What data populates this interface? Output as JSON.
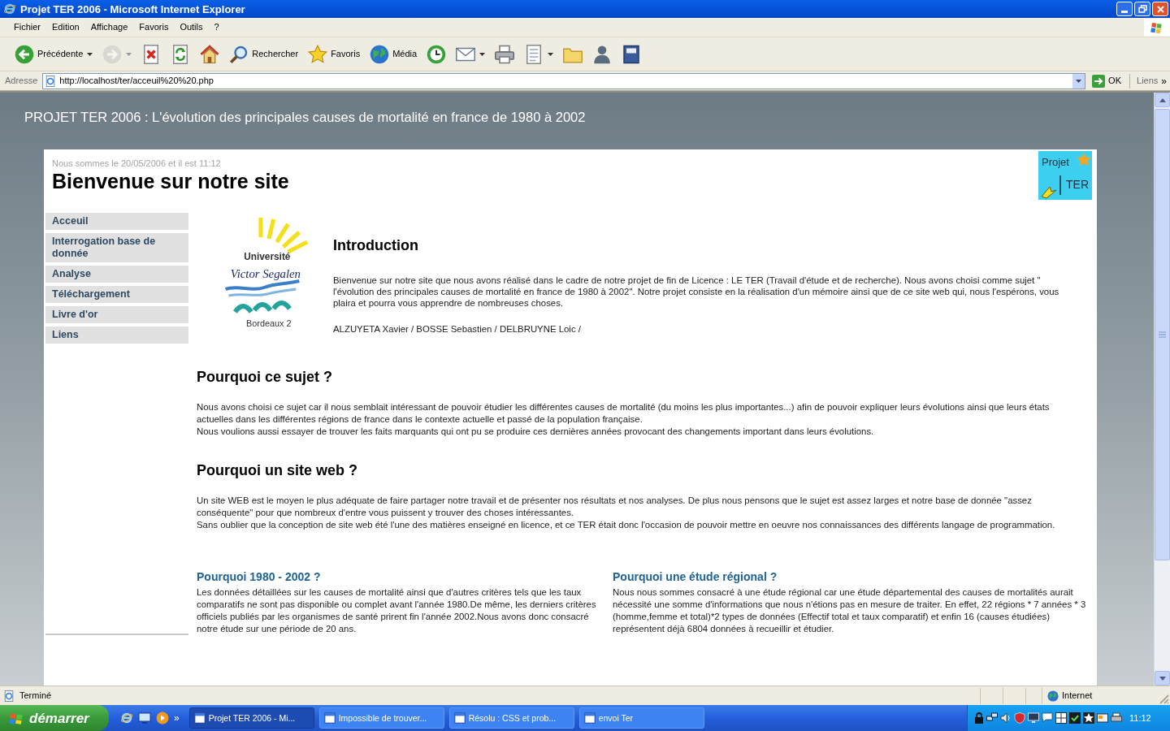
{
  "window": {
    "title": "Projet TER 2006 - Microsoft Internet Explorer"
  },
  "menu": [
    "Fichier",
    "Edition",
    "Affichage",
    "Favoris",
    "Outils",
    "?"
  ],
  "toolbar": [
    {
      "kind": "back",
      "label": "Précédente",
      "dropdown": true,
      "disabled": false
    },
    {
      "kind": "forward",
      "dropdown": true,
      "disabled": true
    },
    {
      "kind": "stop",
      "dropdown": false,
      "disabled": false
    },
    {
      "kind": "refresh",
      "dropdown": false,
      "disabled": false
    },
    {
      "kind": "home",
      "dropdown": false,
      "disabled": false
    },
    {
      "kind": "search",
      "label": "Rechercher",
      "dropdown": false,
      "disabled": false
    },
    {
      "kind": "favorites",
      "label": "Favoris",
      "dropdown": false,
      "disabled": false
    },
    {
      "kind": "media",
      "label": "Média",
      "dropdown": false,
      "disabled": false
    },
    {
      "kind": "history",
      "dropdown": false,
      "disabled": false
    },
    {
      "kind": "mail",
      "dropdown": true,
      "disabled": false
    },
    {
      "kind": "print",
      "dropdown": false,
      "disabled": false
    },
    {
      "kind": "edit",
      "dropdown": true,
      "disabled": false
    },
    {
      "kind": "folder",
      "dropdown": false,
      "disabled": false
    },
    {
      "kind": "messenger",
      "dropdown": false,
      "disabled": false
    },
    {
      "kind": "research",
      "dropdown": false,
      "disabled": false
    }
  ],
  "address_bar": {
    "label": "Adresse",
    "url": "http://localhost/ter/acceuil%20%20.php",
    "go": "OK",
    "links": "Liens",
    "links_chevron": "»"
  },
  "page": {
    "header": "PROJET TER 2006 : L'évolution des principales causes de mortalité en france de 1980 à 2002",
    "date_line": "Nous sommes le 20/05/2006 et il est 11:12",
    "heading": "Bienvenue sur notre site",
    "badge": {
      "lines": [
        "Projet",
        "TER"
      ]
    },
    "nav": [
      "Acceuil",
      "Interrogation base de donnée",
      "Analyse",
      "Téléchargement",
      "Livre d'or",
      "Liens"
    ],
    "logo": {
      "lines": [
        "Université",
        "Victor Segalen",
        "Bordeaux 2"
      ]
    },
    "intro": {
      "title": "Introduction",
      "paragraph": "Bienvenue sur notre site que nous avons réalisé dans le cadre de notre projet de fin de Licence : LE TER (Travail d'étude et de recherche). Nous avons choisi comme sujet \" l'évolution des principales causes de mortalité en france de 1980 à 2002\". Notre projet consiste en la réalisation d'un mémoire ainsi que de ce site web qui, nous l'espérons, vous plaira et pourra vous apprendre de nombreuses choses.",
      "authors": "ALZUYETA Xavier / BOSSE Sebastien / DELBRUYNE Loic /"
    },
    "sections": [
      {
        "title": "Pourquoi ce sujet ?",
        "paragraphs": [
          "Nous avons choisi ce sujet car il nous semblait intéressant de pouvoir étudier les différentes causes de mortalité (du moins les plus importantes...) afin de pouvoir expliquer leurs évolutions ainsi que leurs états actuelles dans les différentes régions de france dans le contexte actuelle et passé de la population française.",
          "Nous voulions aussi essayer de trouver les faits marquants qui ont pu se produire ces dernières années provocant des changements important dans leurs évolutions."
        ]
      },
      {
        "title": "Pourquoi un site web ?",
        "paragraphs": [
          "Un site WEB est le moyen le plus adéquate de faire partager notre travail et de présenter nos résultats et nos analyses. De plus nous pensons que le sujet est assez larges et notre base de donnée \"assez conséquente\" pour que nombreux d'entre vous puissent y trouver des choses intéressantes.",
          "Sans oublier que la conception de site web été l'une des matières enseigné en licence, et ce TER était donc l'occasion de pouvoir mettre en oeuvre nos connaissances des différents langage de programmation."
        ]
      }
    ],
    "columns": [
      {
        "title": "Pourquoi 1980 - 2002 ?",
        "text": "Les données détaillées sur les causes de mortalité ainsi que d'autres critères tels que les taux comparatifs ne sont pas disponible ou complet avant l'année 1980.De même, les derniers critères officiels publiés par les organismes de santé prirent fin l'année 2002.Nous avons donc consacré notre étude sur une période de 20 ans."
      },
      {
        "title": "Pourquoi une étude régional ?",
        "text": "Nous nous sommes consacré à une étude régional car une étude départemental des causes de mortalités aurait nécessité une somme d'informations que nous n'étions pas en mesure de traiter. En effet, 22 régions * 7 années * 3 (homme,femme et total)*2 types de données (Effectif total et taux comparatif) et enfin 16 (causes étudiées) représentent déjà 6804 données à recueillir et étudier."
      }
    ]
  },
  "status_bar": {
    "text": "Terminé",
    "zone": "Internet"
  },
  "taskbar": {
    "start": "démarrer",
    "quick_launch_chevron": "»",
    "tasks": [
      {
        "label": "Projet TER 2006 - Mi...",
        "selected": true
      },
      {
        "label": "Impossible de trouver...",
        "selected": false
      },
      {
        "label": "Résolu : CSS et prob...",
        "selected": false
      },
      {
        "label": "envoi Ter",
        "selected": false
      }
    ],
    "clock": "11:12"
  }
}
